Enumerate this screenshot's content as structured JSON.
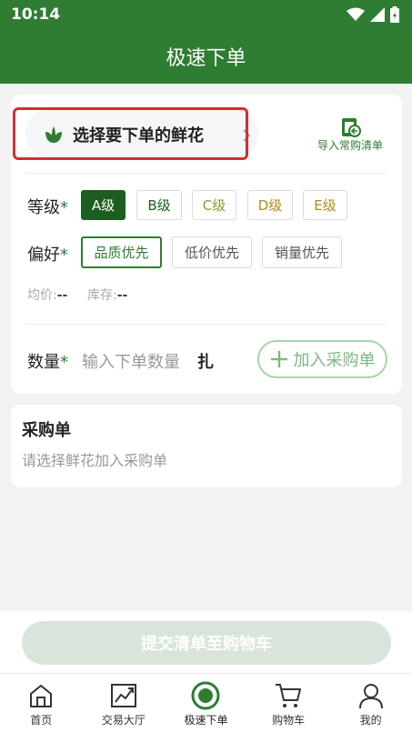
{
  "status_bar": {
    "time": "10:14"
  },
  "header": {
    "title": "极速下单"
  },
  "order_form": {
    "select_flower_label": "选择要下单的鲜花",
    "import_label": "导入常购清单",
    "grade_label": "等级",
    "grades": [
      "A级",
      "B级",
      "C级",
      "D级",
      "E级"
    ],
    "selected_grade": "A级",
    "preference_label": "偏好",
    "preferences": [
      "品质优先",
      "低价优先",
      "销量优先"
    ],
    "selected_preference": "品质优先",
    "avg_price_label": "均价:",
    "avg_price_value": "--",
    "stock_label": "库存:",
    "stock_value": "--",
    "quantity_label": "数量",
    "required_mark": "*",
    "quantity_placeholder": "输入下单数量",
    "quantity_unit": "扎",
    "add_button_label": "加入采购单"
  },
  "purchase_list": {
    "title": "采购单",
    "empty_hint": "请选择鲜花加入采购单"
  },
  "submit": {
    "label": "提交清单至购物车"
  },
  "tabbar": {
    "items": [
      {
        "label": "首页",
        "icon": "home-icon"
      },
      {
        "label": "交易大厅",
        "icon": "trend-chart-icon"
      },
      {
        "label": "极速下单",
        "icon": "quick-order-icon"
      },
      {
        "label": "购物车",
        "icon": "cart-icon"
      },
      {
        "label": "我的",
        "icon": "user-icon"
      }
    ],
    "active_index": 2
  },
  "colors": {
    "primary": "#2e7d32",
    "highlight": "#d32f2f"
  }
}
